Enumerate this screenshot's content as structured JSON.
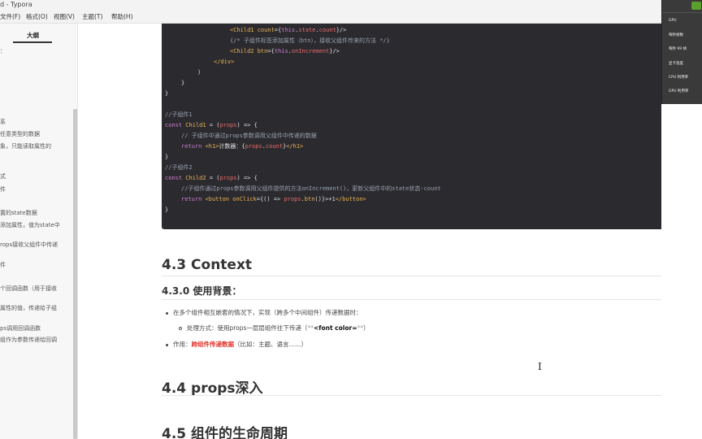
{
  "window": {
    "title": "d - Typora"
  },
  "menu": [
    {
      "label": "文件(F)"
    },
    {
      "label": "格式(O)"
    },
    {
      "label": "视图(V)"
    },
    {
      "label": "主题(T)"
    },
    {
      "label": "帮助(H)"
    }
  ],
  "sidebar": {
    "tab_label": "大纲",
    "items": [
      {
        "text": "："
      },
      {
        "text": "系"
      },
      {
        "text": "任意类型的数据"
      },
      {
        "text": "象，只能读取属性的"
      },
      {
        "text": "式"
      },
      {
        "text": "件"
      },
      {
        "text": "置的state数据"
      },
      {
        "text": "添加属性，值为state中"
      },
      {
        "text": "rops接收父组件中传递"
      },
      {
        "text": "件"
      },
      {
        "text": "个回调函数（用于接收"
      },
      {
        "text": "属性的值，传递给子组"
      },
      {
        "text": "ps调用回调函数"
      },
      {
        "text": "组作为参数传递给回调"
      }
    ]
  },
  "code": {
    "lines": [
      {
        "segments": [
          [
            "tag",
            "<Child1 "
          ],
          [
            "at",
            "count"
          ],
          [
            "pn",
            "={"
          ],
          [
            "kw",
            "this"
          ],
          [
            "pn",
            "."
          ],
          [
            "nm",
            "state"
          ],
          [
            "pn",
            "."
          ],
          [
            "nm",
            "count"
          ],
          [
            "pn",
            "}/>"
          ]
        ]
      },
      {
        "segments": [
          [
            "cm",
            "{/* 子组件标签添加属性（btn），接收父组件传来的方法 */}"
          ]
        ]
      },
      {
        "segments": [
          [
            "tag",
            "<Child2 "
          ],
          [
            "at",
            "btn"
          ],
          [
            "pn",
            "={"
          ],
          [
            "kw",
            "this"
          ],
          [
            "pn",
            "."
          ],
          [
            "nm",
            "onIncrement"
          ],
          [
            "pn",
            "}/>"
          ]
        ]
      },
      {
        "segments": [
          [
            "tag",
            "</div>"
          ]
        ]
      },
      {
        "segments": [
          [
            "pn",
            ")"
          ]
        ]
      },
      {
        "segments": [
          [
            "pn",
            "}"
          ]
        ]
      },
      {
        "segments": [
          [
            "pn",
            "}"
          ]
        ]
      },
      {
        "segments": [
          [
            "wh",
            ""
          ]
        ]
      },
      {
        "segments": [
          [
            "cm",
            "//子组件1"
          ]
        ]
      },
      {
        "segments": [
          [
            "kw",
            "const "
          ],
          [
            "fn",
            "Child1"
          ],
          [
            "pn",
            " = ("
          ],
          [
            "nm",
            "props"
          ],
          [
            "pn",
            ") => {"
          ]
        ]
      },
      {
        "segments": [
          [
            "cm",
            "// 子组件中通过props参数调用父组件中传递的数据"
          ]
        ]
      },
      {
        "segments": [
          [
            "kw",
            "return "
          ],
          [
            "tag",
            "<h1>"
          ],
          [
            "wh",
            "计数器：{"
          ],
          [
            "nm",
            "props"
          ],
          [
            "pn",
            "."
          ],
          [
            "nm",
            "count"
          ],
          [
            "pn",
            "}"
          ],
          [
            "tag",
            "</h1>"
          ]
        ]
      },
      {
        "segments": [
          [
            "pn",
            "}"
          ]
        ]
      },
      {
        "segments": [
          [
            "cm",
            "//子组件2"
          ]
        ]
      },
      {
        "segments": [
          [
            "kw",
            "const "
          ],
          [
            "fn",
            "Child2"
          ],
          [
            "pn",
            " = ("
          ],
          [
            "nm",
            "props"
          ],
          [
            "pn",
            ") => {"
          ]
        ]
      },
      {
        "segments": [
          [
            "cm",
            "//子组件通过props参数调用父组件提供的方法onIncrement()，更新父组件中的state状态-count"
          ]
        ]
      },
      {
        "segments": [
          [
            "kw",
            "return "
          ],
          [
            "tag",
            "<button "
          ],
          [
            "at",
            "onClick"
          ],
          [
            "pn",
            "={() => "
          ],
          [
            "nm",
            "props"
          ],
          [
            "pn",
            "."
          ],
          [
            "fn",
            "btn"
          ],
          [
            "pn",
            "()}>+1"
          ],
          [
            "tag",
            "</button>"
          ]
        ]
      },
      {
        "segments": [
          [
            "pn",
            "}"
          ]
        ]
      }
    ]
  },
  "sections": {
    "h43": "4.3 Context",
    "h430": "4.3.0 使用背景：",
    "bullet1": "在多个组件相互嵌套的情况下，实现（跨多个中间组件）传递数据时：",
    "sub1_prefix": "处理方式：使用props一层层组件往下传递（",
    "sub1_gray1": "**",
    "sub1_bold": "<font color=",
    "sub1_gray2": "**",
    "sub1_suffix": "）",
    "bullet2_prefix": "作用：",
    "bullet2_red": "跨组件传递数据",
    "bullet2_suffix": "（比如：主题、语言……）",
    "h44": "4.4 props深入",
    "h45": "4.5 组件的生命周期"
  },
  "overlay": {
    "rows": [
      {
        "label": "GPU"
      },
      {
        "label": "每秒帧数"
      },
      {
        "label": "每秒 99 帧"
      },
      {
        "label": "显卡温度"
      },
      {
        "label": "CPU 利用率"
      },
      {
        "label": "GPU 利用率"
      }
    ]
  },
  "colors": {
    "accent_green": "#5aa02c",
    "red_text": "#e0322a",
    "code_bg": "#2b2b2f"
  }
}
